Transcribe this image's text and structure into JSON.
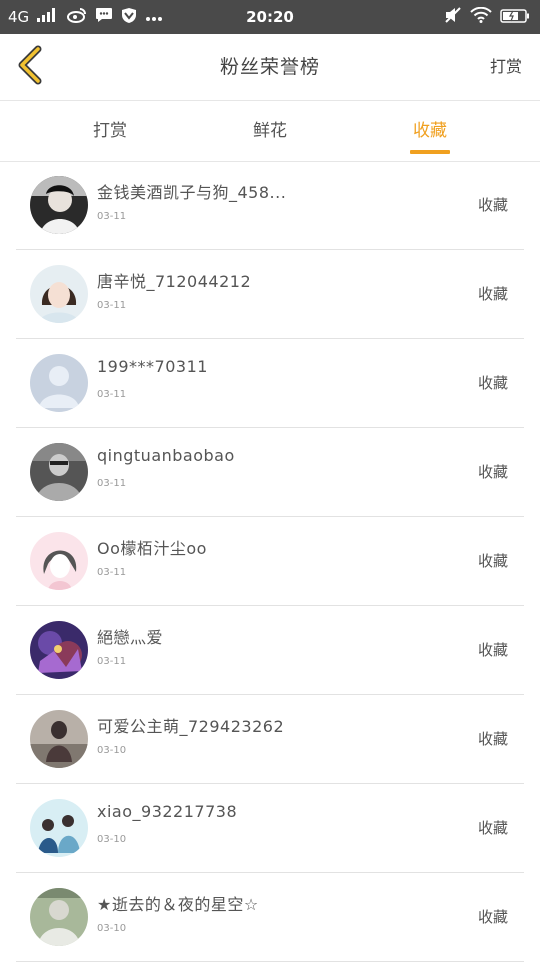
{
  "status_bar": {
    "network": "4G",
    "time": "20:20"
  },
  "header": {
    "title": "粉丝荣誉榜",
    "right_label": "打赏"
  },
  "tabs": [
    {
      "label": "打赏",
      "active": false
    },
    {
      "label": "鲜花",
      "active": false
    },
    {
      "label": "收藏",
      "active": true
    }
  ],
  "colors": {
    "accent": "#f0a020",
    "status_bar": "#4a4a4a"
  },
  "rows": [
    {
      "name": "金钱美酒凯子与狗_458...",
      "date": "03-11",
      "action": "收藏"
    },
    {
      "name": "唐辛悦_712044212",
      "date": "03-11",
      "action": "收藏"
    },
    {
      "name": "199***70311",
      "date": "03-11",
      "action": "收藏"
    },
    {
      "name": "qingtuanbaobao",
      "date": "03-11",
      "action": "收藏"
    },
    {
      "name": "Oo檬栢汁尘oo",
      "date": "03-11",
      "action": "收藏"
    },
    {
      "name": "絕戀灬爱",
      "date": "03-11",
      "action": "收藏"
    },
    {
      "name": "可爱公主萌_729423262",
      "date": "03-10",
      "action": "收藏"
    },
    {
      "name": "xiao_932217738",
      "date": "03-10",
      "action": "收藏"
    },
    {
      "name": "★逝去的＆夜的星空☆",
      "date": "03-10",
      "action": "收藏"
    }
  ]
}
